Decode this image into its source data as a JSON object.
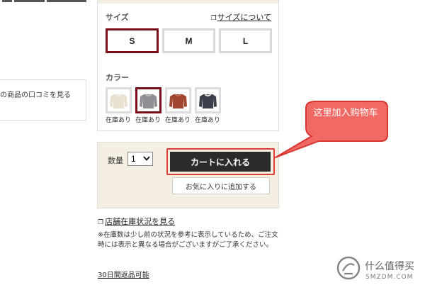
{
  "size_section": {
    "title": "サイズ",
    "guide_link": "サイズについて",
    "options": [
      "S",
      "M",
      "L"
    ],
    "selected": "S"
  },
  "color_section": {
    "title": "カラー",
    "swatches": [
      {
        "label": "在庫あり",
        "color": "#e9e1cf",
        "collar": "#f6f2e7",
        "selected": false
      },
      {
        "label": "在庫あり",
        "color": "#8e8e94",
        "collar": "#b9b9bd",
        "selected": true
      },
      {
        "label": "在庫あり",
        "color": "#a2472f",
        "collar": "#c06a50",
        "selected": false
      },
      {
        "label": "在庫あり",
        "color": "#3b404a",
        "collar": "#e1e1e1",
        "selected": false
      }
    ]
  },
  "cart": {
    "quantity_label": "数量",
    "quantity_value": "1",
    "add_to_cart_label": "カートに入れる",
    "favorite_label": "お気に入りに追加する"
  },
  "links": {
    "store_stock": "店舗在庫状況を見る",
    "returns": "30日間返品可能"
  },
  "note": "※在庫数は少し前の状況を参考に表示しているため、ご注文時には表示と異なる場合がございますがご了承ください。",
  "left_panel": {
    "review_link": "の商品の口コミを見る"
  },
  "annotation": {
    "text": "这里加入购物车",
    "color": "#e23c36"
  },
  "watermark": {
    "name": "什么值得买",
    "domain": "SMZDM.COM"
  },
  "colors": {
    "accent": "#7a0f1c",
    "cart_button": "#2b2b2b",
    "cart_box_bg": "#f4efe0"
  }
}
